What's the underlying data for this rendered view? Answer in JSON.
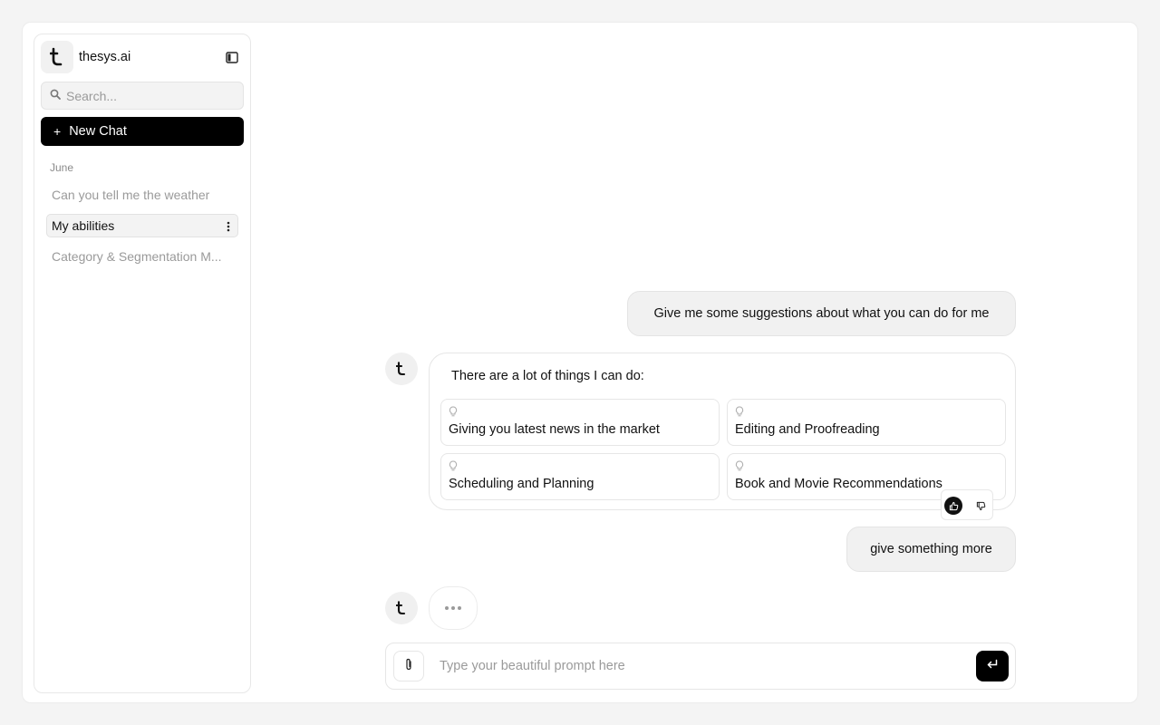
{
  "sidebar": {
    "brand": "thesys.ai",
    "search_placeholder": "Search...",
    "new_chat_label": "New Chat",
    "section_label": "June",
    "history": [
      {
        "label": "Can you tell me the weather",
        "active": false
      },
      {
        "label": "My abilities",
        "active": true
      },
      {
        "label": "Category & Segmentation M...",
        "active": false
      }
    ]
  },
  "chat": {
    "user_message_1": "Give me some suggestions about what you can do for me",
    "assistant_intro": "There are a lot of things I can do:",
    "suggestions": [
      "Giving you latest news in the market",
      "Editing and Proofreading",
      "Scheduling and Planning",
      "Book and Movie Recommendations"
    ],
    "user_message_2": "give something more",
    "composer_placeholder": "Type your beautiful prompt here"
  },
  "icons": {
    "logo": "thesys-logo-icon",
    "collapse": "sidebar-toggle-icon",
    "search": "search-icon",
    "plus": "plus-icon",
    "kebab": "more-vertical-icon",
    "bulb": "lightbulb-icon",
    "thumbs_up": "thumbs-up-icon",
    "thumbs_down": "thumbs-down-icon",
    "attach": "paperclip-icon",
    "send": "enter-icon"
  },
  "colors": {
    "accent": "#000000",
    "muted_text": "#9a9a9a",
    "bubble_bg": "#f1f1f1"
  }
}
